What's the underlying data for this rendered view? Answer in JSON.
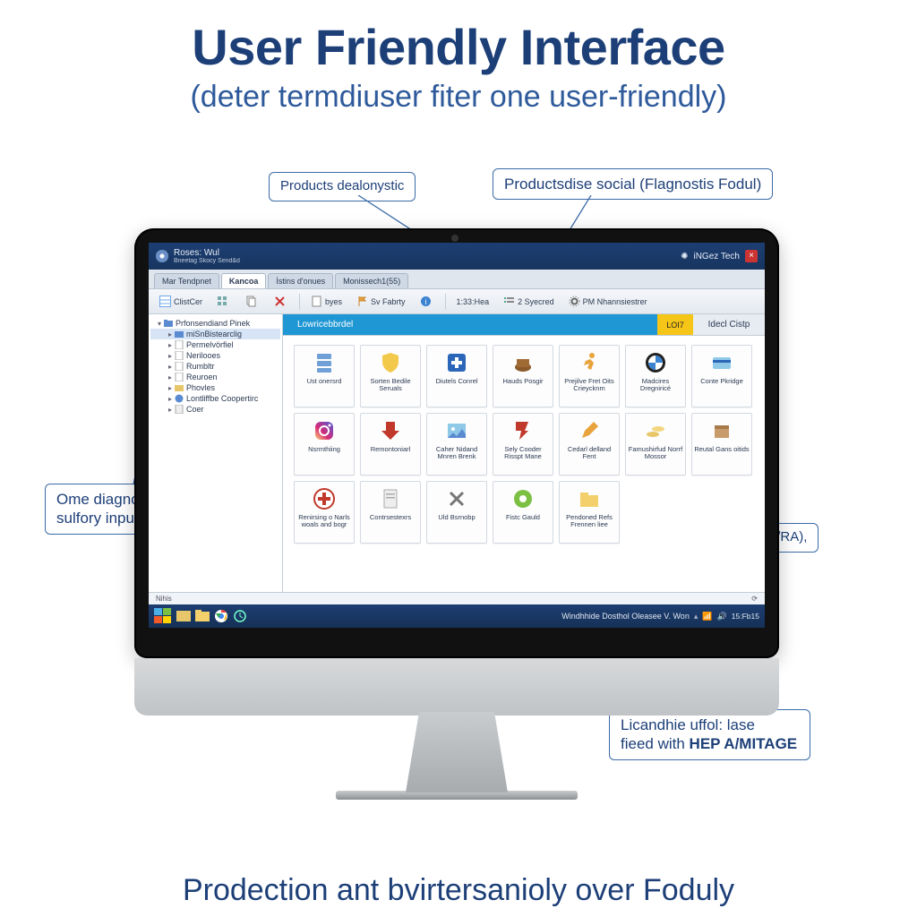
{
  "headline": {
    "title": "User Friendly Interface",
    "subtitle": "(deter termdiuser fiter one user-friendly)"
  },
  "footerline": "Prodection ant bvirtersanioly over Foduly",
  "callouts": {
    "top_left": "Products dealonystic",
    "top_right": "Productsdise social (Flagnostis Fodul)",
    "left": "Ome diagnote sulfory inpulble)",
    "mid_right": "Padiler ôoagonrities, easy (M/RA),",
    "bottom_right_line1": "Licandhie uffol: lase",
    "bottom_right_line2": "fieed with HEP A/MITAGE"
  },
  "app": {
    "brand": "Roses: Wul",
    "brand_sub": "Bneetag Skocy Send&d",
    "header_right": "iNGez Tech",
    "tabs": [
      "Mar Tendpnet",
      "Kancoa",
      "İstins d'onues",
      "Monissech1(55)"
    ],
    "active_tab_index": 1,
    "toolbar": [
      {
        "label": "ClistCer",
        "icon": "table"
      },
      {
        "label": "",
        "icon": "grid"
      },
      {
        "label": "",
        "icon": "copy"
      },
      {
        "label": "",
        "icon": "x"
      },
      {
        "label": "byes",
        "icon": "doc"
      },
      {
        "label": "Sv Fabrty",
        "icon": "flag"
      },
      {
        "label": "",
        "icon": "info"
      },
      {
        "label": "1:33:Hea",
        "icon": ""
      },
      {
        "label": "2 Syecred",
        "icon": "list"
      },
      {
        "label": "PM Nhannsiestrer",
        "icon": "gear"
      }
    ],
    "sidebar": {
      "root": "Prfonsendiand Pinek",
      "items": [
        {
          "label": "miSnBistearclig",
          "icon": "folder-blue",
          "selected": true
        },
        {
          "label": "Permelvörfiel",
          "icon": "doc"
        },
        {
          "label": "Nerilooes",
          "icon": "doc"
        },
        {
          "label": "Rumbltr",
          "icon": "doc"
        },
        {
          "label": "Reuroen",
          "icon": "doc"
        },
        {
          "label": "Phovles",
          "icon": "folder-yellow"
        },
        {
          "label": "Lontliffbe Coopertirc",
          "icon": "world"
        },
        {
          "label": "Coer",
          "icon": "page"
        }
      ]
    },
    "main_tabs": {
      "blue": "Lowricebbrdel",
      "yellow": "LOI7",
      "plain": "Idecl Cistp"
    },
    "cards": [
      {
        "label": "Ust onersrd",
        "icon": "server"
      },
      {
        "label": "Sorten Bedile Seruals",
        "icon": "shield-y"
      },
      {
        "label": "Diutels Conrel",
        "icon": "cross-blue"
      },
      {
        "label": "Hauds Posgir",
        "icon": "pot"
      },
      {
        "label": "Prejilve Fret Oits Crieycknm",
        "icon": "runner"
      },
      {
        "label": "Madcires Dregniricé",
        "icon": "bmw"
      },
      {
        "label": "Conte Pkridge",
        "icon": "card"
      },
      {
        "label": "Nsrmthiing",
        "icon": "insta"
      },
      {
        "label": "Remontoniarl",
        "icon": "down-red"
      },
      {
        "label": "Caher Nidand Mnren Brenk",
        "icon": "pic"
      },
      {
        "label": "Sely Cooder Risspt Mane",
        "icon": "arrow-red"
      },
      {
        "label": "Cedarl delland Fent",
        "icon": "pen"
      },
      {
        "label": "Famushirfud Norrf Mossor",
        "icon": "coins"
      },
      {
        "label": "Reutal Gans oitids",
        "icon": "box"
      },
      {
        "label": "Renirsing o Narls woals and bogr",
        "icon": "plus-red"
      },
      {
        "label": "Contrsestexrs",
        "icon": "doc-g"
      },
      {
        "label": "Uld Bsrnobp",
        "icon": "x-grey"
      },
      {
        "label": "Fistc Gauld",
        "icon": "green"
      },
      {
        "label": "Pendoned Refs Frennen liee",
        "icon": "folder-y"
      }
    ],
    "statusbar_text": "Nihis",
    "status_icon": "refresh"
  },
  "taskbar": {
    "left_icons": [
      "start",
      "explorer",
      "folder",
      "chrome",
      "clock"
    ],
    "right_text": "Windhhide Dosthol Oleasee V. Won",
    "clock": "15:Fb15"
  }
}
